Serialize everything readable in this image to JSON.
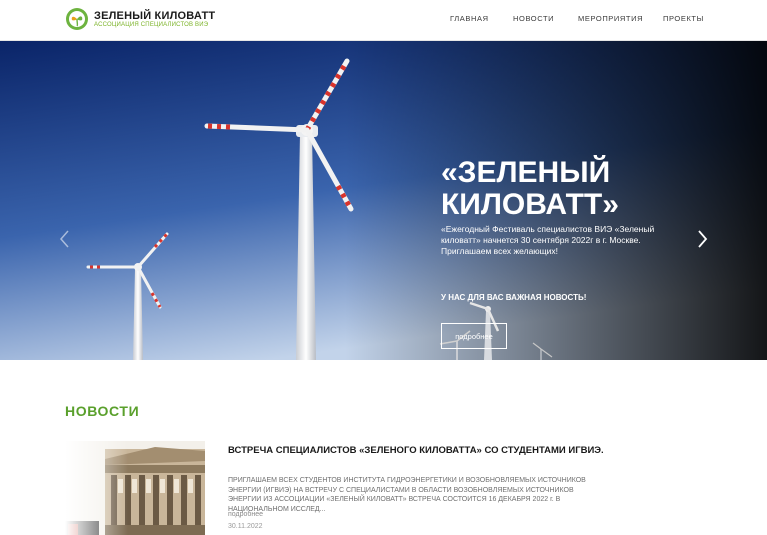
{
  "header": {
    "brand_title": "ЗЕЛЕНЫЙ КИЛОВАТТ",
    "brand_subtitle": "АССОЦИАЦИЯ СПЕЦИАЛИСТОВ ВИЭ",
    "nav": [
      "ГЛАВНАЯ",
      "НОВОСТИ",
      "МЕРОПРИЯТИЯ",
      "ПРОЕКТЫ"
    ]
  },
  "hero": {
    "title_line1": "«ЗЕЛЕНЫЙ",
    "title_line2": "КИЛОВАТТ»",
    "description": "«Ежегодный Фестиваль специалистов ВИЭ «Зеленый киловатт» начнется 30 сентября 2022г в г. Москве. Приглашаем всех желающих!",
    "news_label": "У НАС ДЛЯ ВАС ВАЖНАЯ НОВОСТЬ!",
    "button_label": "подробнее",
    "slide_count": 3,
    "active_slide": 1
  },
  "news_section": {
    "heading": "НОВОСТИ",
    "items": [
      {
        "title": "ВСТРЕЧА СПЕЦИАЛИСТОВ «ЗЕЛЕНОГО КИЛОВАТТА» СО СТУДЕНТАМИ ИГВИЭ.",
        "excerpt": "ПРИГЛАШАЕМ ВСЕХ СТУДЕНТОВ ИНСТИТУТА ГИДРОЭНЕРГЕТИКИ И ВОЗОБНОВЛЯЕМЫХ ИСТОЧНИКОВ ЭНЕРГИИ (ИГВИЭ) НА ВСТРЕЧУ С СПЕЦИАЛИСТАМИ В ОБЛАСТИ ВОЗОБНОВЛЯЕМЫХ ИСТОЧНИКОВ ЭНЕРГИИ ИЗ АССОЦИАЦИИ «ЗЕЛЕНЫЙ КИЛОВАТТ» ВСТРЕЧА СОСТОИТСЯ 16 ДЕКАБРЯ 2022 г. В НАЦИОНАЛЬНОМ ИССЛЕД...",
        "more_label": "подробнее",
        "date": "30.11.2022"
      }
    ]
  },
  "colors": {
    "accent": "#5aa02c",
    "sky_top": "#0b2a72",
    "sky_bottom": "#b7cbe6"
  }
}
